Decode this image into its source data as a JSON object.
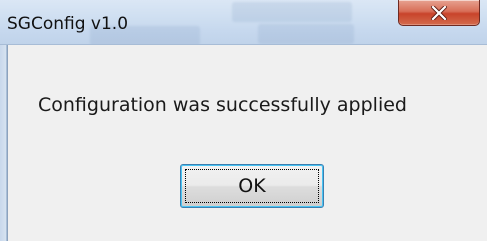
{
  "window": {
    "title": "SGConfig v1.0",
    "close_icon": "close-icon"
  },
  "dialog": {
    "message": "Configuration was successfully applied",
    "ok_label": "OK"
  },
  "colors": {
    "close_button": "#c8442b",
    "titlebar": "#cfdff1",
    "body": "#f0f0f0",
    "button_focus": "#3c7fb1"
  }
}
